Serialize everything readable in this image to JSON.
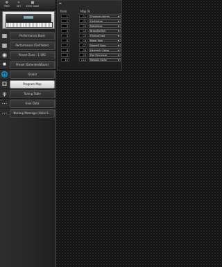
{
  "toolbar": {
    "buttons": [
      {
        "label": "PREF",
        "icon": "gear-icon"
      },
      {
        "label": "SET",
        "icon": "tool-icon"
      },
      {
        "label": "KEYS SAVE",
        "icon": "keys-icon"
      }
    ]
  },
  "menu": {
    "items": [
      {
        "label": "Performance Bank",
        "active": false,
        "icon": "grid-icon"
      },
      {
        "label": "Performance (Ted'Voter)",
        "active": false,
        "icon": "grid-icon"
      },
      {
        "label": "Preset Zone : 1 SRC",
        "active": false,
        "icon": "circle-icon"
      },
      {
        "label": "Preset (ExtendedWave)",
        "active": false,
        "icon": "square-icon"
      },
      {
        "label": "Global",
        "active": false,
        "icon": "globe-icon"
      },
      {
        "label": "Program Map",
        "active": true,
        "icon": "dice-icon"
      },
      {
        "label": "Tuning Table",
        "active": false,
        "icon": "tuning-fork-icon"
      },
      {
        "label": "User Data",
        "active": false,
        "icon": "dots-icon"
      },
      {
        "label": "Backup Message (Hello S...",
        "active": false,
        "icon": "dots-icon"
      }
    ]
  },
  "program_map": {
    "title": "▾▸",
    "col_from": "from",
    "col_to": "Map To",
    "rows": [
      {
        "from": "1",
        "cc": "C1",
        "name": "Chamber-Voices"
      },
      {
        "from": "2",
        "cc": "C2",
        "name": "Orchestral"
      },
      {
        "from": "3",
        "cc": "C3",
        "name": "Matallicos"
      },
      {
        "from": "4",
        "cc": "C4",
        "name": "BrassSection"
      },
      {
        "from": "5",
        "cc": "C5",
        "name": "ChorusChoir"
      },
      {
        "from": "6",
        "cc": "C6",
        "name": "Major Solo"
      },
      {
        "from": "7",
        "cc": "C7",
        "name": "Sweetfl Saxo"
      },
      {
        "from": "8",
        "cc": "C8",
        "name": "Heavenly Saloo"
      },
      {
        "from": "9",
        "cc": "C9",
        "name": "Pop Percussio"
      },
      {
        "from": "10",
        "cc": "C10",
        "name": "Melodic Kalim"
      }
    ]
  }
}
